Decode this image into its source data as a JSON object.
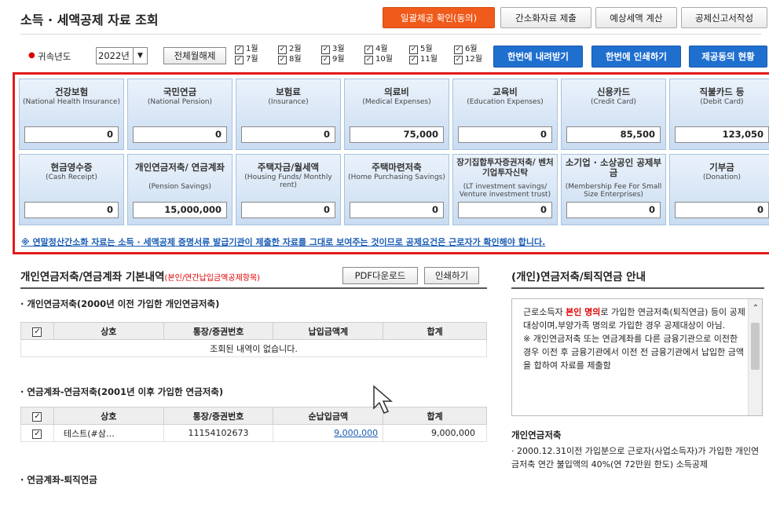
{
  "header": {
    "title": "소득 · 세액공제 자료 조회",
    "buttons": [
      "일괄제공 확인(동의)",
      "간소화자료 제출",
      "예상세액 계산",
      "공제신고서작성"
    ]
  },
  "filter": {
    "year_label": "귀속년도",
    "year_value": "2022년",
    "deselect_all": "전체월해제",
    "months": [
      "1월",
      "2월",
      "3월",
      "4월",
      "5월",
      "6월",
      "7월",
      "8월",
      "9월",
      "10월",
      "11월",
      "12월"
    ],
    "actions": [
      "한번에 내려받기",
      "한번에 인쇄하기",
      "제공동의 현황"
    ]
  },
  "summary": {
    "row1": [
      {
        "kr": "건강보험",
        "en": "(National Health Insurance)",
        "value": "0"
      },
      {
        "kr": "국민연금",
        "en": "(National Pension)",
        "value": "0"
      },
      {
        "kr": "보험료",
        "en": "(Insurance)",
        "value": "0"
      },
      {
        "kr": "의료비",
        "en": "(Medical Expenses)",
        "value": "75,000"
      },
      {
        "kr": "교육비",
        "en": "(Education Expenses)",
        "value": "0"
      },
      {
        "kr": "신용카드",
        "en": "(Credit Card)",
        "value": "85,500"
      },
      {
        "kr": "직불카드 등",
        "en": "(Debit Card)",
        "value": "123,050"
      }
    ],
    "row2": [
      {
        "kr": "현금영수증",
        "en": "(Cash Receipt)",
        "value": "0"
      },
      {
        "kr": "개인연금저축/ 연금계좌",
        "en": "(Pension Savings)",
        "value": "15,000,000"
      },
      {
        "kr": "주택자금/월세액",
        "en": "(Housing Funds/ Monthly rent)",
        "value": "0"
      },
      {
        "kr": "주택마련저축",
        "en": "(Home Purchasing Savings)",
        "value": "0"
      },
      {
        "kr": "장기집합투자증권저축/ 벤처기업투자신탁",
        "en": "(LT investment savings/ Venture investment trust)",
        "value": "0"
      },
      {
        "kr": "소기업 · 소상공인 공제부금",
        "en": "(Membership Fee For Small Size Enterprises)",
        "value": "0"
      },
      {
        "kr": "기부금",
        "en": "(Donation)",
        "value": "0"
      }
    ],
    "notice": "※ 연말정산간소화 자료는 소득 · 세액공제 증명서류 발급기관이 제출한 자료를 그대로 보여주는 것이므로 공제요건은 근로자가 확인해야 합니다."
  },
  "section": {
    "title": "개인연금저축/연금계좌 기본내역",
    "title_note": "(본인/연간납입금액공제항목)",
    "pdf_button": "PDF다운로드",
    "print_button": "인쇄하기",
    "sub1": {
      "title": "· 개인연금저축(2000년 이전 가입한 개인연금저축)",
      "headers": [
        "상호",
        "통장/증권번호",
        "납입금액계",
        "합계"
      ],
      "empty": "조회된 내역이 없습니다."
    },
    "sub2": {
      "title": "· 연금계좌-연금저축(2001년 이후 가입한 연금저축)",
      "headers": [
        "상호",
        "통장/증권번호",
        "순납입금액",
        "합계"
      ],
      "rows": [
        {
          "name": "테스트(#삼…",
          "account": "11154102673",
          "amount": "9,000,000",
          "total": "9,000,000"
        }
      ]
    },
    "sub3": {
      "title": "· 연금계좌-퇴직연금"
    }
  },
  "right_panel": {
    "title": "(개인)연금저축/퇴직연금 안내",
    "intro_pre": "근로소득자 ",
    "intro_red": "본인 명의",
    "intro_post": "로 가입한 연금저축(퇴직연금) 등이 공제 대상이며,부양가족 명의로 가입한 경우 공제대상이 아님.",
    "note": "※ 개인연금저축 또는 연금계좌를 다른 금융기관으로 이전한 경우 이전 후 금융기관에서 이전 전 금융기관에서 납입한 금액을 합하여 자료를 제출함",
    "h2": "개인연금저축",
    "desc": "· 2000.12.31이전 가입분으로 근로자(사업소득자)가 가입한 개인연금저축 연간 불입액의 40%(연 72만원 한도) 소득공제"
  }
}
